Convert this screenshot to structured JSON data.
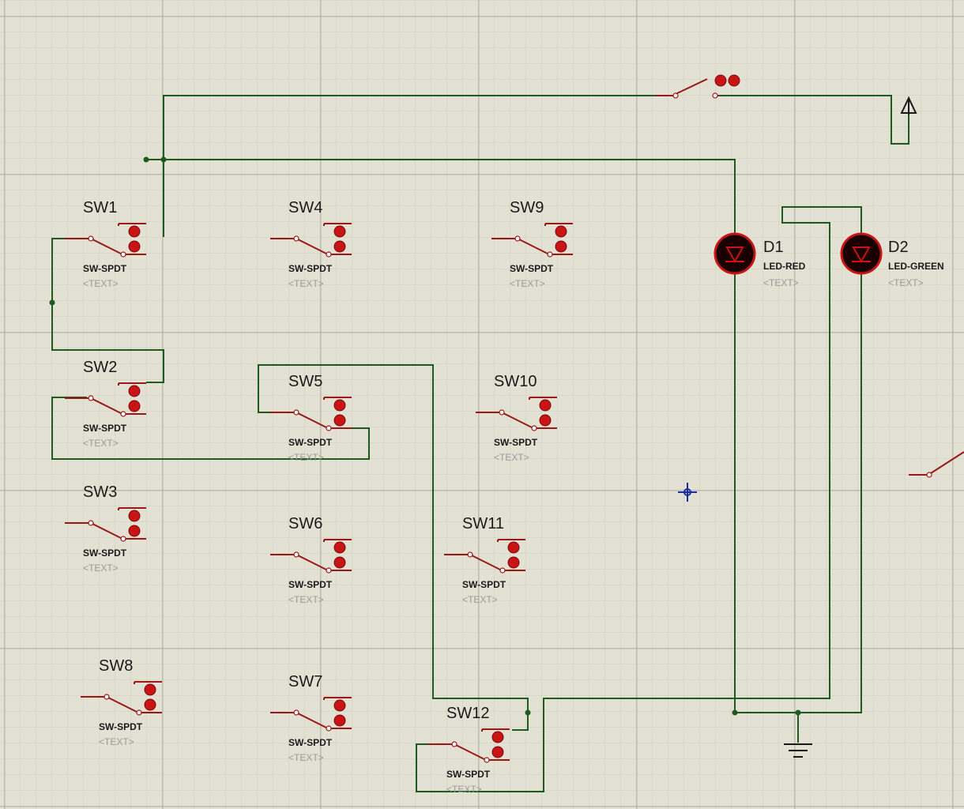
{
  "switches": [
    {
      "ref": "SW1",
      "value": "SW-SPDT",
      "text": "<TEXT>"
    },
    {
      "ref": "SW4",
      "value": "SW-SPDT",
      "text": "<TEXT>"
    },
    {
      "ref": "SW9",
      "value": "SW-SPDT",
      "text": "<TEXT>"
    },
    {
      "ref": "SW2",
      "value": "SW-SPDT",
      "text": "<TEXT>"
    },
    {
      "ref": "SW5",
      "value": "SW-SPDT",
      "text": "<TEXT>"
    },
    {
      "ref": "SW10",
      "value": "SW-SPDT",
      "text": "<TEXT>"
    },
    {
      "ref": "SW3",
      "value": "SW-SPDT",
      "text": "<TEXT>"
    },
    {
      "ref": "SW6",
      "value": "SW-SPDT",
      "text": "<TEXT>"
    },
    {
      "ref": "SW11",
      "value": "SW-SPDT",
      "text": "<TEXT>"
    },
    {
      "ref": "SW8",
      "value": "SW-SPDT",
      "text": "<TEXT>"
    },
    {
      "ref": "SW7",
      "value": "SW-SPDT",
      "text": "<TEXT>"
    },
    {
      "ref": "SW12",
      "value": "SW-SPDT",
      "text": "<TEXT>"
    }
  ],
  "leds": [
    {
      "ref": "D1",
      "value": "LED-RED",
      "text": "<TEXT>",
      "color": "#c81414"
    },
    {
      "ref": "D2",
      "value": "LED-GREEN",
      "text": "<TEXT>",
      "color": "#c81414"
    }
  ],
  "colors": {
    "background": "#e3e1d3",
    "grid_minor": "#cfcdbd",
    "grid_major": "#bdbbab",
    "wire": "#1f5a1f",
    "component": "#9a1818",
    "button": "#c81414",
    "cursor": "#1a2fa0"
  },
  "icons": [
    "switch-spdt-icon",
    "push-button-icon",
    "led-icon",
    "ground-icon",
    "power-terminal-icon",
    "crosshair-cursor-icon"
  ]
}
